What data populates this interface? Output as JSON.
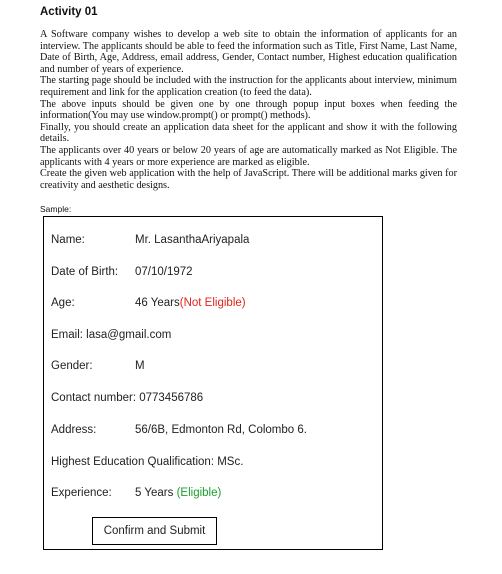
{
  "doc": {
    "title": "Activity 01",
    "paragraphs": [
      "A Software company wishes to develop a web site to obtain the information of applicants for an interview. The applicants should be able to feed the information such as Title, First Name, Last Name, Date of Birth, Age, Address, email address, Gender, Contact number, Highest education qualification and number of years of experience.",
      "The starting page should be included with the instruction for the applicants about interview, minimum requirement and link for the application creation (to feed the data).",
      "The above inputs should be given one by one through popup input boxes when feeding the information(You may use window.prompt() or prompt() methods).",
      "Finally, you should create an application data sheet for the applicant and show it with the following details.",
      "The applicants over 40 years or below 20 years of age are automatically marked as Not Eligible. The applicants with 4 years or more experience are marked as eligible.",
      "Create the given web application with the help of JavaScript. There will be additional marks given for creativity and aesthetic designs."
    ],
    "sample_label": "Sample:"
  },
  "sheet": {
    "name_label": "Name:",
    "name_value": "Mr. LasanthaAriyapala",
    "dob_label": "Date of Birth:",
    "dob_value": "07/10/1972",
    "age_label": "Age:",
    "age_value": "46 Years",
    "age_status": "(Not Eligible)",
    "email_text": "Email:  lasa@gmail.com",
    "gender_label": "Gender:",
    "gender_value": "M",
    "contact_text": "Contact number: 0773456786",
    "address_label": "Address:",
    "address_value": "56/6B, Edmonton Rd, Colombo 6.",
    "qualification_text": "Highest Education Qualification: MSc.",
    "experience_label": "Experience:",
    "experience_value": "5 Years",
    "experience_status": "(Eligible)",
    "button_label": "Confirm and Submit"
  },
  "colors": {
    "not_eligible": "#e0241b",
    "eligible": "#1aa02e"
  }
}
